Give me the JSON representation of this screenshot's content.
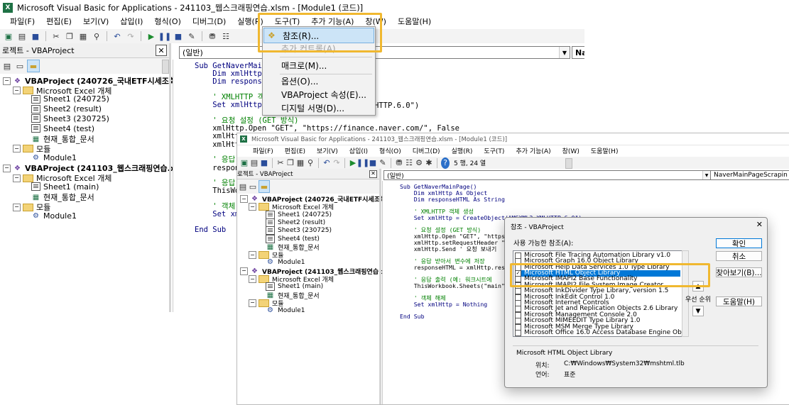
{
  "back_window": {
    "title": "Microsoft Visual Basic for Applications - 241103_웹스크래핑연습.xlsm - [Module1 (코드)]",
    "menu": [
      "파일(F)",
      "편집(E)",
      "보기(V)",
      "삽입(I)",
      "형식(O)",
      "디버그(D)",
      "실행(R)",
      "도구(T)",
      "추가 기능(A)",
      "창(W)",
      "도움말(H)"
    ],
    "project_pane_title": "로젝트 - VBAProject",
    "tree": [
      {
        "label": "VBAProject (240726_국내ETF시세조회.",
        "bold": true,
        "icon": "vba-project-icon",
        "level": 0
      },
      {
        "label": "Microsoft Excel 개체",
        "icon": "folder-icon",
        "level": 1
      },
      {
        "label": "Sheet1 (240725)",
        "icon": "sheet-icon",
        "level": 2
      },
      {
        "label": "Sheet2 (result)",
        "icon": "sheet-icon",
        "level": 2
      },
      {
        "label": "Sheet3 (230725)",
        "icon": "sheet-icon",
        "level": 2
      },
      {
        "label": "Sheet4 (test)",
        "icon": "sheet-icon",
        "level": 2
      },
      {
        "label": "현재_통합_문서",
        "icon": "workbook-icon",
        "level": 2
      },
      {
        "label": "모듈",
        "icon": "folder-icon",
        "level": 1
      },
      {
        "label": "Module1",
        "icon": "module-icon",
        "level": 2
      },
      {
        "label": "VBAProject (241103_웹스크래핑연습.xl",
        "bold": true,
        "icon": "vba-project-icon",
        "level": 0
      },
      {
        "label": "Microsoft Excel 개체",
        "icon": "folder-icon",
        "level": 1
      },
      {
        "label": "Sheet1 (main)",
        "icon": "sheet-icon",
        "level": 2
      },
      {
        "label": "현재_통합_문서",
        "icon": "workbook-icon",
        "level": 2
      },
      {
        "label": "모듈",
        "icon": "folder-icon",
        "level": 1
      },
      {
        "label": "Module1",
        "icon": "module-icon",
        "level": 2
      }
    ],
    "object_combo": "(일반)",
    "proc_combo": "Na",
    "code_lines": [
      "Sub GetNaverMain",
      "    Dim xmlHttp",
      "    Dim response",
      "",
      "    ' XMLHTTP 객",
      "    Set xmlHttp",
      "",
      "    ' 요청 설정 (GET 방식)",
      "    xmlHttp.Open \"GET\", \"https://finance.naver.com/\", False",
      "    xmlHttp",
      "    xmlHttp",
      "",
      "    ' 응답",
      "    respons",
      "",
      "    ' 응답",
      "    ThisWo",
      "",
      "    ' 객체",
      "    Set xm",
      "",
      "End Sub"
    ],
    "code_tail_line6": "HTTP.6.0\")"
  },
  "tools_menu": {
    "items": [
      {
        "label": "참조(R)...",
        "selected": true,
        "disabled": false
      },
      {
        "label": "추가 컨트롤(A)...",
        "selected": false,
        "disabled": true
      },
      {
        "label": "매크로(M)...",
        "selected": false,
        "disabled": false
      },
      {
        "label": "옵션(O)...",
        "selected": false,
        "disabled": false
      },
      {
        "label": "VBAProject 속성(E)...",
        "selected": false,
        "disabled": false
      },
      {
        "label": "디지털 서명(D)...",
        "selected": false,
        "disabled": false
      }
    ]
  },
  "front_window": {
    "title": "Microsoft Visual Basic for Applications - 241103_웹스크래핑연습.xlsm - [Module1 (코드)]",
    "menu": [
      "파일(F)",
      "편집(E)",
      "보기(V)",
      "삽입(I)",
      "형식(O)",
      "디버그(D)",
      "실행(R)",
      "도구(T)",
      "추가 기능(A)",
      "창(W)",
      "도움말(H)"
    ],
    "position_text": "5 행, 24 열",
    "project_pane_title": "로젝트 - VBAProject",
    "object_combo": "(일반)",
    "proc_combo": "NaverMainPageScrapin",
    "code_lines": [
      "Sub GetNaverMainPage()",
      "    Dim xmlHttp As Object",
      "    Dim responseHTML As String",
      "",
      "    ' XMLHTTP 객체 생성",
      "    Set xmlHttp = CreateObject(\"MSXML2.XMLHTTP.6.0\")",
      "",
      "    ' 요청 설정 (GET 방식)",
      "    xmlHttp.Open \"GET\", \"https",
      "    xmlHttp.setRequestHeader \"",
      "    xmlHttp.Send ' 요청 보내기",
      "",
      "    ' 응답 받아서 변수에 저장",
      "    responseHTML = xmlHttp.res",
      "",
      "    ' 응답 출력 (예: 워크시트에",
      "    ThisWorkbook.Sheets(\"main\"",
      "",
      "    ' 객체 해제",
      "    Set xmlHttp = Nothing",
      "",
      "End Sub"
    ]
  },
  "references_dialog": {
    "title": "참조 - VBAProject",
    "available_label": "사용 가능한 참조(A):",
    "items": [
      {
        "label": "Microsoft File Tracing Automation Library v1.0",
        "checked": false,
        "selected": false
      },
      {
        "label": "Microsoft Graph 16.0 Object Library",
        "checked": false,
        "selected": false
      },
      {
        "label": "Microsoft Help Data Services 1.0 Type Library",
        "checked": false,
        "selected": false
      },
      {
        "label": "Microsoft HTML Object Library",
        "checked": true,
        "selected": true
      },
      {
        "label": "Microsoft IMAPI2 Base Functionality",
        "checked": false,
        "selected": false
      },
      {
        "label": "Microsoft IMAPI2 File System Image Creator",
        "checked": false,
        "selected": false
      },
      {
        "label": "Microsoft InkDivider Type Library, version 1.5",
        "checked": false,
        "selected": false
      },
      {
        "label": "Microsoft InkEdit Control 1.0",
        "checked": false,
        "selected": false
      },
      {
        "label": "Microsoft Internet Controls",
        "checked": false,
        "selected": false
      },
      {
        "label": "Microsoft Jet and Replication Objects 2.6 Library",
        "checked": false,
        "selected": false
      },
      {
        "label": "Microsoft Management Console 2.0",
        "checked": false,
        "selected": false
      },
      {
        "label": "Microsoft MIMEEDIT Type Library 1.0",
        "checked": false,
        "selected": false
      },
      {
        "label": "Microsoft MSM Merge Type Library",
        "checked": false,
        "selected": false
      },
      {
        "label": "Microsoft Office 16.0 Access Database Engine Object",
        "checked": false,
        "selected": false
      }
    ],
    "buttons": {
      "ok": "확인",
      "cancel": "취소",
      "browse": "찾아보기(B)...",
      "help": "도움말(H)"
    },
    "priority_label": "우선 순위",
    "selected_name": "Microsoft HTML Object Library",
    "location_label": "위치:",
    "location_value": "C:₩Windows₩System32₩mshtml.tlb",
    "language_label": "언어:",
    "language_value": "표준"
  }
}
